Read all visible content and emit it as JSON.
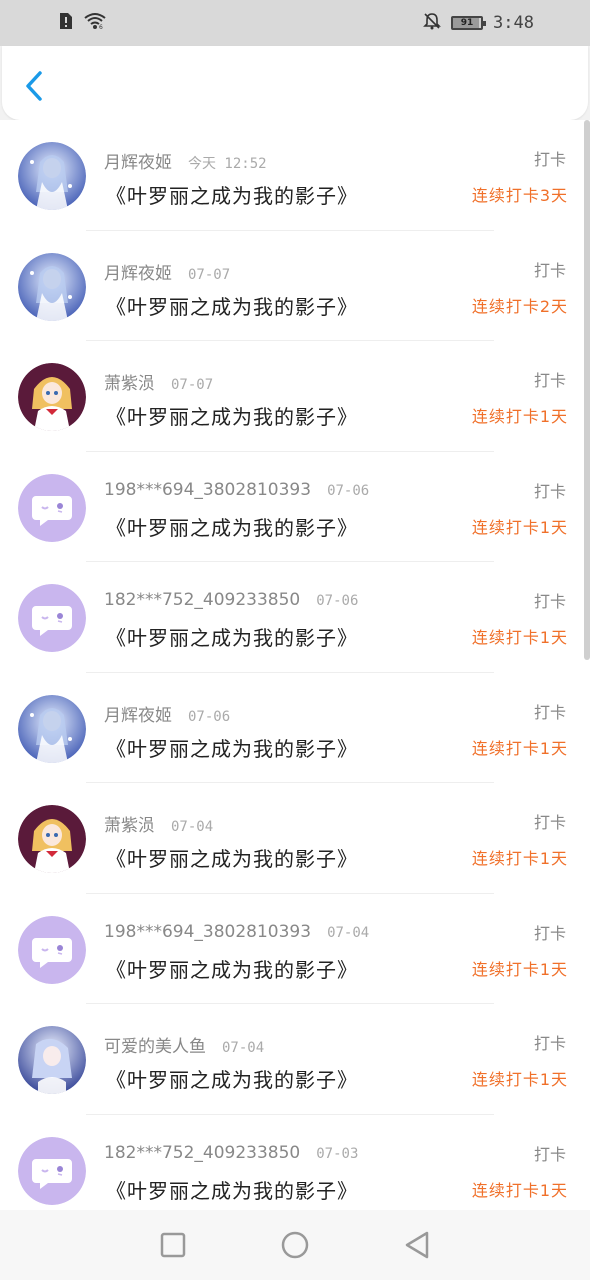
{
  "status_bar": {
    "time": "3:48",
    "battery_level": "91",
    "battery_fraction": 0.91
  },
  "header": {
    "back_icon": "chevron-left-icon"
  },
  "list": {
    "items": [
      {
        "name": "月辉夜姬",
        "date": "今天 12:52",
        "title": "《叶罗丽之成为我的影子》",
        "tag": "打卡",
        "streak": "连续打卡3天",
        "avatar": "anime-avatar-blue"
      },
      {
        "name": "月辉夜姬",
        "date": "07-07",
        "title": "《叶罗丽之成为我的影子》",
        "tag": "打卡",
        "streak": "连续打卡2天",
        "avatar": "anime-avatar-blue"
      },
      {
        "name": "萧紫涢",
        "date": "07-07",
        "title": "《叶罗丽之成为我的影子》",
        "tag": "打卡",
        "streak": "连续打卡1天",
        "avatar": "anime-avatar-red"
      },
      {
        "name": "198***694_3802810393",
        "date": "07-06",
        "title": "《叶罗丽之成为我的影子》",
        "tag": "打卡",
        "streak": "连续打卡1天",
        "avatar": "default-chat-avatar"
      },
      {
        "name": "182***752_409233850",
        "date": "07-06",
        "title": "《叶罗丽之成为我的影子》",
        "tag": "打卡",
        "streak": "连续打卡1天",
        "avatar": "default-chat-avatar"
      },
      {
        "name": "月辉夜姬",
        "date": "07-06",
        "title": "《叶罗丽之成为我的影子》",
        "tag": "打卡",
        "streak": "连续打卡1天",
        "avatar": "anime-avatar-blue"
      },
      {
        "name": "萧紫涢",
        "date": "07-04",
        "title": "《叶罗丽之成为我的影子》",
        "tag": "打卡",
        "streak": "连续打卡1天",
        "avatar": "anime-avatar-red"
      },
      {
        "name": "198***694_3802810393",
        "date": "07-04",
        "title": "《叶罗丽之成为我的影子》",
        "tag": "打卡",
        "streak": "连续打卡1天",
        "avatar": "default-chat-avatar"
      },
      {
        "name": "可爱的美人鱼",
        "date": "07-04",
        "title": "《叶罗丽之成为我的影子》",
        "tag": "打卡",
        "streak": "连续打卡1天",
        "avatar": "anime-avatar-mermaid"
      },
      {
        "name": "182***752_409233850",
        "date": "07-03",
        "title": "《叶罗丽之成为我的影子》",
        "tag": "打卡",
        "streak": "连续打卡1天",
        "avatar": "default-chat-avatar"
      }
    ]
  },
  "nav_bar": {
    "recents_icon": "square-icon",
    "home_icon": "circle-icon",
    "back_icon": "triangle-back-icon"
  },
  "colors": {
    "accent": "#1a9ae8",
    "streak": "#f0702a",
    "default_avatar_bg": "#c9b6ee"
  }
}
